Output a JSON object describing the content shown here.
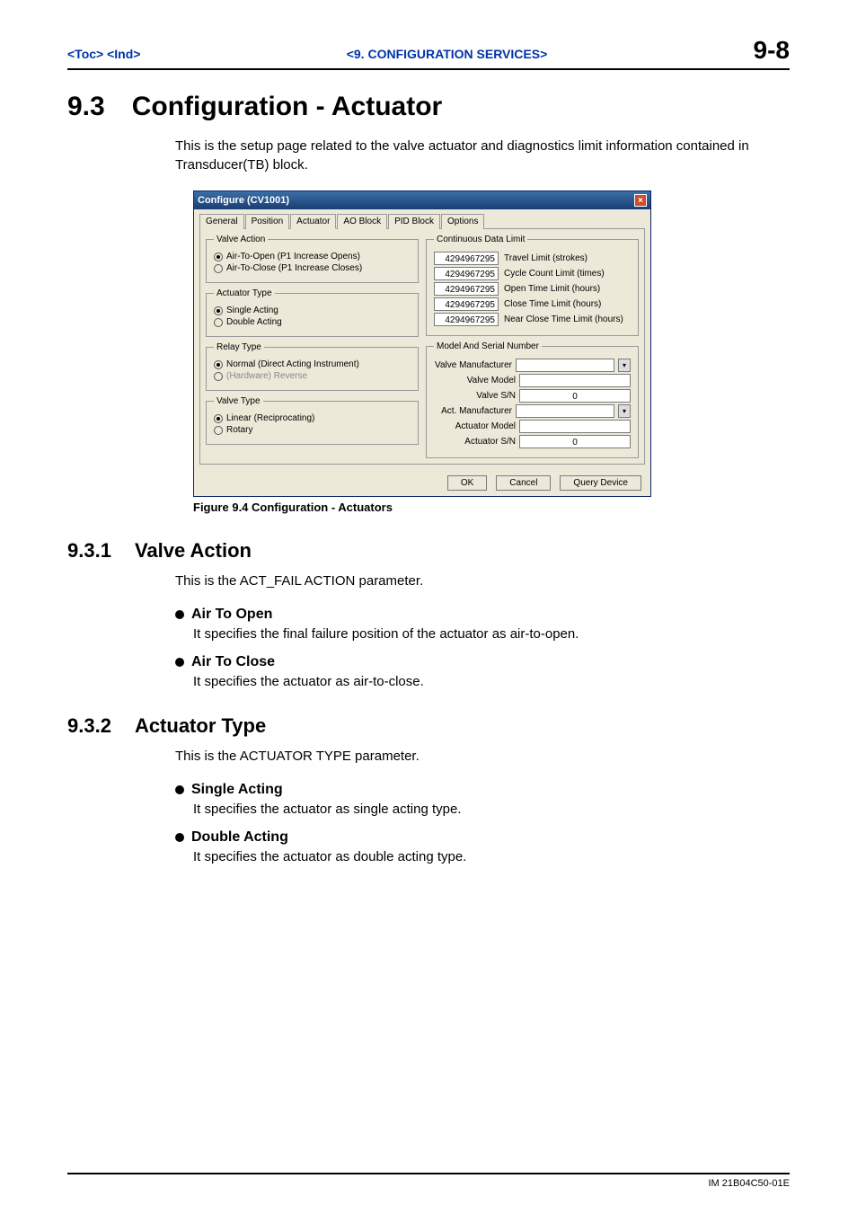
{
  "header": {
    "toc": "<Toc>",
    "ind": "<Ind>",
    "center": "<9.  CONFIGURATION SERVICES>",
    "pagenum": "9-8"
  },
  "h1": {
    "num": "9.3",
    "title": "Configuration - Actuator"
  },
  "intro": "This is the setup page related to the valve actuator and diagnostics limit information contained in Transducer(TB) block.",
  "figure_caption": "Figure 9.4 Configuration  - Actuators",
  "dialog": {
    "title": "Configure (CV1001)",
    "tabs": [
      "General",
      "Position",
      "Actuator",
      "AO Block",
      "PID Block",
      "Options"
    ],
    "valve_action": {
      "legend": "Valve Action",
      "opt1": "Air-To-Open (P1 Increase Opens)",
      "opt2": "Air-To-Close (P1 Increase Closes)"
    },
    "actuator_type": {
      "legend": "Actuator Type",
      "opt1": "Single Acting",
      "opt2": "Double Acting"
    },
    "relay_type": {
      "legend": "Relay Type",
      "opt1": "Normal (Direct Acting Instrument)",
      "opt2": "(Hardware) Reverse"
    },
    "valve_type": {
      "legend": "Valve Type",
      "opt1": "Linear (Reciprocating)",
      "opt2": "Rotary"
    },
    "cont_limit": {
      "legend": "Continuous Data Limit",
      "rows": [
        {
          "val": "4294967295",
          "label": "Travel Limit  (strokes)"
        },
        {
          "val": "4294967295",
          "label": "Cycle Count Limit  (times)"
        },
        {
          "val": "4294967295",
          "label": "Open Time Limit  (hours)"
        },
        {
          "val": "4294967295",
          "label": "Close Time Limit  (hours)"
        },
        {
          "val": "4294967295",
          "label": "Near Close Time Limit  (hours)"
        }
      ]
    },
    "model_serial": {
      "legend": "Model And Serial Number",
      "valve_mfr": "Valve Manufacturer",
      "valve_model": "Valve Model",
      "valve_sn": "Valve S/N",
      "valve_sn_val": "0",
      "act_mfr": "Act. Manufacturer",
      "act_model": "Actuator Model",
      "act_sn": "Actuator S/N",
      "act_sn_val": "0"
    },
    "buttons": {
      "ok": "OK",
      "cancel": "Cancel",
      "query": "Query Device"
    }
  },
  "s931": {
    "num": "9.3.1",
    "title": "Valve Action",
    "intro": "This is the ACT_FAIL ACTION parameter.",
    "b1": "Air To Open",
    "b1t": "It specifies the final failure position of the actuator as air-to-open.",
    "b2": "Air To Close",
    "b2t": "It specifies the actuator as air-to-close."
  },
  "s932": {
    "num": "9.3.2",
    "title": "Actuator Type",
    "intro": "This is the ACTUATOR TYPE parameter.",
    "b1": "Single Acting",
    "b1t": "It specifies the actuator as single acting type.",
    "b2": "Double Acting",
    "b2t": "It specifies the actuator as double acting type."
  },
  "footer": "IM 21B04C50-01E"
}
